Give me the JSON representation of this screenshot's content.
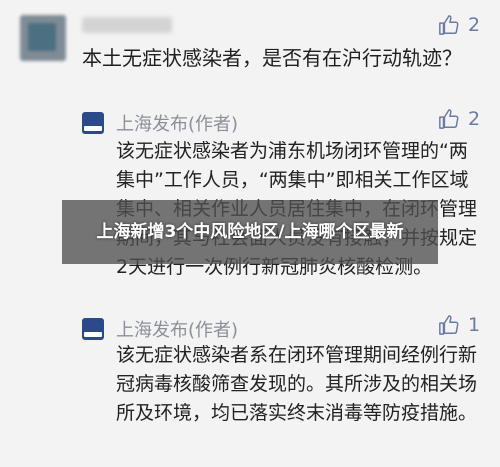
{
  "question": {
    "text": "本土无症状感染者，是否有在沪行动轨迹？",
    "likes": "2"
  },
  "replies": [
    {
      "author": "上海发布(作者)",
      "likes": "2",
      "text": "该无症状感染者为浦东机场闭环管理的“两集中”工作人员，“两集中”即相关工作区域集中、相关作业人员居住集中，在闭环管理期间，其与社会面人员没有接触，并按规定2天进行一次例行新冠肺炎核酸检测。"
    },
    {
      "author": "上海发布(作者)",
      "likes": "1",
      "text": "该无症状感染者系在闭环管理期间经例行新冠病毒核酸筛查发现的。其所涉及的相关场所及环境，均已落实终末消毒等防疫措施。"
    }
  ],
  "overlay": {
    "title": "上海新增3个中风险地区/上海哪个区最新"
  },
  "icons": {
    "like": "thumbs-up-icon",
    "author_logo": "shanghai-fabu-logo-icon"
  },
  "colors": {
    "like": "#6b7aa5",
    "author_name": "#8a8f99",
    "logo": "#2a4a8a"
  }
}
